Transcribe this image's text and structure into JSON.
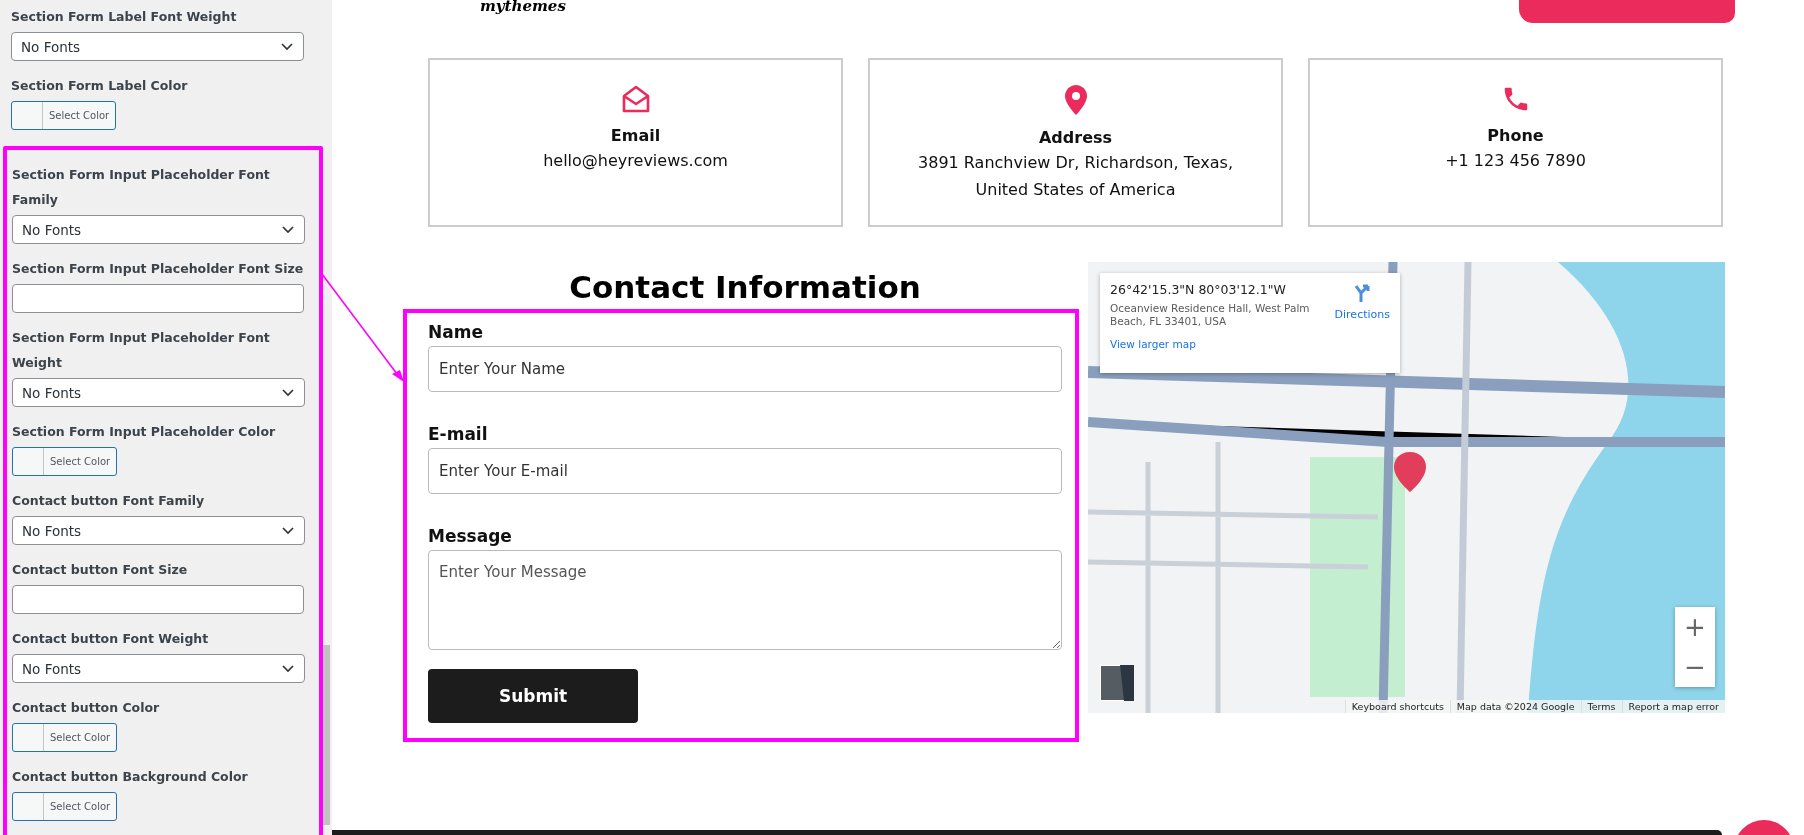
{
  "sidebar": {
    "settings": [
      {
        "label": "Section Form Label Font Weight",
        "kind": "select",
        "value": "No Fonts"
      },
      {
        "label": "Section Form Label Color",
        "kind": "color",
        "value": "Select Color"
      }
    ],
    "highlighted_settings": [
      {
        "label": "Section Form Input Placeholder Font Family",
        "kind": "select",
        "value": "No Fonts"
      },
      {
        "label": "Section Form Input Placeholder Font Size",
        "kind": "text"
      },
      {
        "label": "Section Form Input Placeholder Font Weight",
        "kind": "select",
        "value": "No Fonts"
      },
      {
        "label": "Section Form Input Placeholder Color",
        "kind": "color",
        "value": "Select Color"
      },
      {
        "label": "Contact button Font Family",
        "kind": "select",
        "value": "No Fonts"
      },
      {
        "label": "Contact button Font Size",
        "kind": "text"
      },
      {
        "label": "Contact button Font Weight",
        "kind": "select",
        "value": "No Fonts"
      },
      {
        "label": "Contact button Color",
        "kind": "color",
        "value": "Select Color"
      },
      {
        "label": "Contact button Background Color",
        "kind": "color",
        "value": "Select Color"
      }
    ]
  },
  "header": {
    "logo": "mythemes"
  },
  "info_cards": [
    {
      "kind": "email",
      "title": "Email",
      "value": "hello@heyreviews.com"
    },
    {
      "kind": "address",
      "title": "Address",
      "value": "3891 Ranchview Dr, Richardson, Texas, United States of America"
    },
    {
      "kind": "phone",
      "title": "Phone",
      "value": "+1 123 456 7890"
    }
  ],
  "contact_form": {
    "heading": "Contact Information",
    "fields": [
      {
        "kind": "input",
        "label": "Name",
        "placeholder": "Enter Your Name"
      },
      {
        "kind": "input",
        "label": "E-mail",
        "placeholder": "Enter Your E-mail"
      },
      {
        "kind": "textarea",
        "label": "Message",
        "placeholder": "Enter Your Message"
      }
    ],
    "submit": "Submit"
  },
  "map": {
    "info": {
      "coordinates": "26°42'15.3\"N 80°03'12.1\"W",
      "address": "Oceanview Residence Hall, West Palm Beach, FL 33401, USA",
      "directions": "Directions",
      "larger_map": "View larger map"
    },
    "zoom_in": "+",
    "zoom_out": "−",
    "attribution": [
      "Keyboard shortcuts",
      "Map data ©2024 Google",
      "Terms",
      "Report a map error"
    ]
  }
}
